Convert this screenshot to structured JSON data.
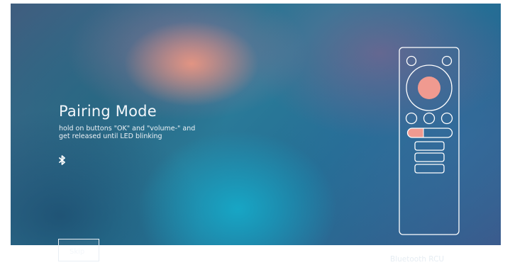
{
  "pairing": {
    "title": "Pairing Mode",
    "instruction": "hold on buttons \"OK\" and \"volume-\" and get released until LED blinking",
    "status_icon": "bluetooth-icon"
  },
  "actions": {
    "skip_label": "Skip"
  },
  "remote": {
    "icon": "remote-control-icon",
    "highlight_color": "#f09a90",
    "outline_color": "#ffffff"
  },
  "device_caption": "Bluetooth RCU"
}
